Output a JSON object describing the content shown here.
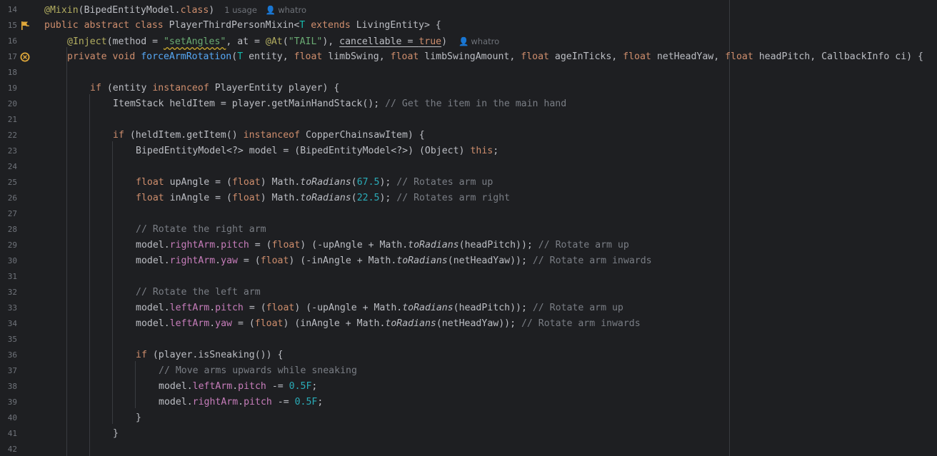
{
  "gutter": {
    "line_numbers": [
      "14",
      "15",
      "16",
      "17",
      "18",
      "19",
      "20",
      "21",
      "22",
      "23",
      "24",
      "25",
      "26",
      "27",
      "28",
      "29",
      "30",
      "31",
      "32",
      "33",
      "34",
      "35",
      "36",
      "37",
      "38",
      "39",
      "40",
      "41",
      "42"
    ],
    "icons": [
      "mixin-target-icon",
      "method-override-icon"
    ]
  },
  "hints": {
    "usage": "1 usage",
    "author1": "whatro",
    "author2": "whatro"
  },
  "code": {
    "l14_ann": "@Mixin",
    "l14_rest": "(BipedEntityModel.",
    "l14_class": "class",
    "l14_close": ")",
    "l15_kw": "public abstract class ",
    "l15_name": "PlayerThirdPersonMixin<",
    "l15_T": "T",
    "l15_ext": " extends ",
    "l15_rest": "LivingEntity> {",
    "l16_ann": "@Inject",
    "l16_a": "(method = ",
    "l16_str1": "\"setAngles\"",
    "l16_b": ", at = ",
    "l16_ann2": "@At",
    "l16_c": "(",
    "l16_str2": "\"TAIL\"",
    "l16_d": "), ",
    "l16_cancel": "cancellable",
    "l16_e": " = ",
    "l16_true": "true",
    "l16_f": ")",
    "l17_kw": "private void ",
    "l17_fn": "forceArmRotation",
    "l17_a": "(",
    "l17_T": "T",
    "l17_b": " entity, ",
    "l17_f1": "float",
    "l17_c": " limbSwing, ",
    "l17_f2": "float",
    "l17_d": " limbSwingAmount, ",
    "l17_f3": "float",
    "l17_e": " ageInTicks, ",
    "l17_f4": "float",
    "l17_g": " netHeadYaw, ",
    "l17_f5": "float",
    "l17_h": " headPitch, CallbackInfo ci) {",
    "l19_if": "if",
    "l19_a": " (entity ",
    "l19_inst": "instanceof",
    "l19_b": " PlayerEntity player) {",
    "l20_code": "ItemStack heldItem = player.getMainHandStack(); ",
    "l20_cmt": "// Get the item in the main hand",
    "l22_if": "if",
    "l22_a": " (heldItem.getItem() ",
    "l22_inst": "instanceof",
    "l22_b": " CopperChainsawItem) {",
    "l23_a": "BipedEntityModel<?> model = (BipedEntityModel<?>) (Object) ",
    "l23_this": "this",
    "l23_b": ";",
    "l25_float": "float",
    "l25_a": " upAngle = (",
    "l25_float2": "float",
    "l25_b": ") Math.",
    "l25_fn": "toRadians",
    "l25_c": "(",
    "l25_num": "67.5",
    "l25_d": "); ",
    "l25_cmt": "// Rotates arm up",
    "l26_float": "float",
    "l26_a": " inAngle = (",
    "l26_float2": "float",
    "l26_b": ") Math.",
    "l26_fn": "toRadians",
    "l26_c": "(",
    "l26_num": "22.5",
    "l26_d": "); ",
    "l26_cmt": "// Rotates arm right",
    "l28_cmt": "// Rotate the right arm",
    "l29_a": "model.",
    "l29_f1": "rightArm",
    "l29_b": ".",
    "l29_f2": "pitch",
    "l29_c": " = (",
    "l29_float": "float",
    "l29_d": ") (-upAngle + Math.",
    "l29_fn": "toRadians",
    "l29_e": "(headPitch)); ",
    "l29_cmt": "// Rotate arm up",
    "l30_a": "model.",
    "l30_f1": "rightArm",
    "l30_b": ".",
    "l30_f2": "yaw",
    "l30_c": " = (",
    "l30_float": "float",
    "l30_d": ") (-inAngle + Math.",
    "l30_fn": "toRadians",
    "l30_e": "(netHeadYaw)); ",
    "l30_cmt": "// Rotate arm inwards",
    "l32_cmt": "// Rotate the left arm",
    "l33_a": "model.",
    "l33_f1": "leftArm",
    "l33_b": ".",
    "l33_f2": "pitch",
    "l33_c": " = (",
    "l33_float": "float",
    "l33_d": ") (-upAngle + Math.",
    "l33_fn": "toRadians",
    "l33_e": "(headPitch)); ",
    "l33_cmt": "// Rotate arm up",
    "l34_a": "model.",
    "l34_f1": "leftArm",
    "l34_b": ".",
    "l34_f2": "yaw",
    "l34_c": " = (",
    "l34_float": "float",
    "l34_d": ") (inAngle + Math.",
    "l34_fn": "toRadians",
    "l34_e": "(netHeadYaw)); ",
    "l34_cmt": "// Rotate arm inwards",
    "l36_if": "if",
    "l36_a": " (player.isSneaking()) {",
    "l37_cmt": "// Move arms upwards while sneaking",
    "l38_a": "model.",
    "l38_f1": "leftArm",
    "l38_b": ".",
    "l38_f2": "pitch",
    "l38_c": " -= ",
    "l38_num": "0.5F",
    "l38_d": ";",
    "l39_a": "model.",
    "l39_f1": "rightArm",
    "l39_b": ".",
    "l39_f2": "pitch",
    "l39_c": " -= ",
    "l39_num": "0.5F",
    "l39_d": ";",
    "l40": "}",
    "l41": "}"
  },
  "colors": {
    "background": "#1e1f22",
    "keyword": "#cf8e6d",
    "annotation": "#b3ae60",
    "string": "#6aab73",
    "number": "#2aacb8",
    "comment": "#7a7e85",
    "field": "#c77dbb",
    "function": "#56a8f5"
  }
}
